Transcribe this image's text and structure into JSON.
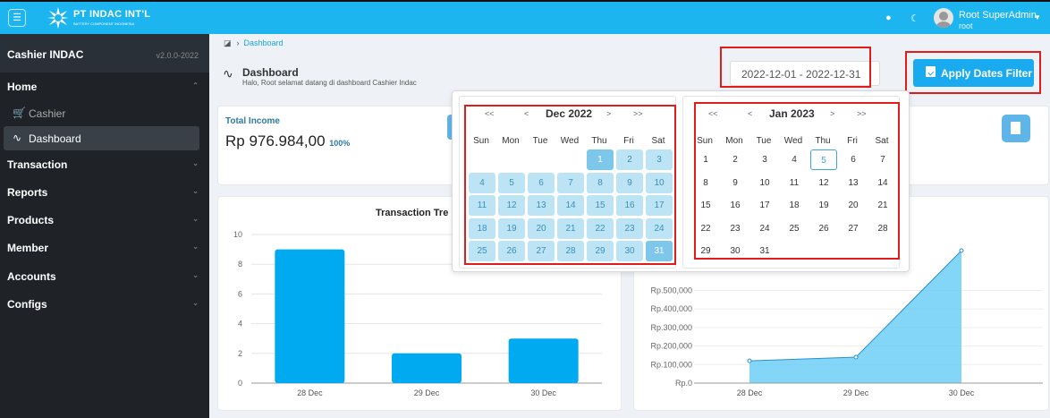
{
  "topbar": {
    "brand": "PT INDAC INT'L",
    "brand_sub": "BATTERY COMPONENT INDONESIA",
    "user_name": "Root SuperAdmin",
    "user_role": "root",
    "icons": [
      "menu-icon",
      "bell-icon",
      "moon-icon",
      "avatar",
      "chevron-down-icon"
    ]
  },
  "sidebar": {
    "app_name": "Cashier INDAC",
    "version": "v2.0.0-2022",
    "items": [
      {
        "label": "Home",
        "chev": "^"
      },
      {
        "label": "Cashier",
        "icon": "cart-icon"
      },
      {
        "label": "Dashboard",
        "icon": "pulse-icon",
        "active": true
      },
      {
        "label": "Transaction",
        "chev": "v"
      },
      {
        "label": "Reports",
        "chev": "v"
      },
      {
        "label": "Products",
        "chev": "v"
      },
      {
        "label": "Member",
        "chev": "v"
      },
      {
        "label": "Accounts",
        "chev": "v"
      },
      {
        "label": "Configs",
        "chev": "v"
      }
    ]
  },
  "breadcrumb": {
    "current": "Dashboard"
  },
  "page": {
    "title": "Dashboard",
    "subtitle": "Halo, Root selamat datang di dashboard Cashier Indac"
  },
  "filter": {
    "date_range": "2022-12-01 - 2022-12-31",
    "apply_label": "Apply Dates Filter"
  },
  "total_income": {
    "label": "Total Income",
    "value": "Rp 976.984,00",
    "pct": "100%"
  },
  "calendar": {
    "nav_prev2": "<<",
    "nav_prev": "<",
    "nav_next": ">",
    "nav_next2": ">>",
    "dow": [
      "Sun",
      "Mon",
      "Tue",
      "Wed",
      "Thu",
      "Fri",
      "Sat"
    ],
    "left": {
      "month": "Dec 2022",
      "start_offset": 4,
      "days": 31,
      "range_start": 1,
      "range_end": 31
    },
    "right": {
      "month": "Jan 2023",
      "start_offset": 0,
      "days": 31,
      "today": 5
    }
  },
  "chart_data": [
    {
      "type": "bar",
      "title": "Transaction Tre",
      "categories": [
        "28 Dec",
        "29 Dec",
        "30 Dec"
      ],
      "values": [
        9,
        2,
        3
      ],
      "ylim": [
        0,
        10
      ],
      "yticks": [
        0,
        2,
        4,
        6,
        8,
        10
      ],
      "color": "#00aaf0",
      "grid": true
    },
    {
      "type": "area",
      "categories": [
        "28 Dec",
        "29 Dec",
        "30 Dec"
      ],
      "values": [
        120000,
        140000,
        900000
      ],
      "ylim": [
        0,
        500000
      ],
      "yticks": [
        "Rp.0",
        "Rp.100,000",
        "Rp.200,000",
        "Rp.300,000",
        "Rp.400,000",
        "Rp.500,000"
      ],
      "color": "#5bc8f5",
      "grid": true
    }
  ]
}
